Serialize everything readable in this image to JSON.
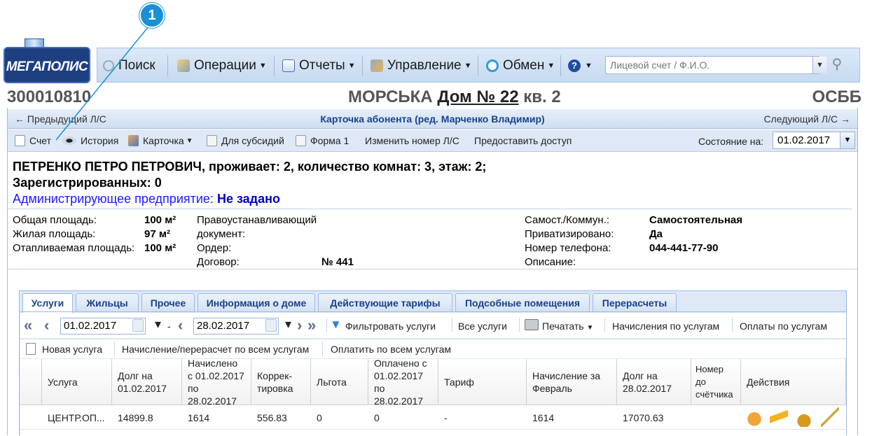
{
  "callout": {
    "number": "1"
  },
  "logo": {
    "text": "МЕГАПОЛИС"
  },
  "menu": {
    "items": [
      {
        "label": "Поиск",
        "icon": "search-icon"
      },
      {
        "label": "Операции",
        "icon": "operations-icon"
      },
      {
        "label": "Отчеты",
        "icon": "reports-icon"
      },
      {
        "label": "Управление",
        "icon": "tools-icon"
      },
      {
        "label": "Обмен",
        "icon": "exchange-icon"
      },
      {
        "label": "",
        "icon": "help-icon"
      }
    ],
    "search_placeholder": "Лицевой счет / Ф.И.О."
  },
  "header": {
    "account": "300010810",
    "street": "МОРСЬКА",
    "house": "Дом № 22",
    "apartment": "кв. 2",
    "org": "ОСББ"
  },
  "card": {
    "prev": "← Предыдущий Л/С",
    "title": "Карточка абонента (ред. Марченко Владимир)",
    "next": "Следующий Л/С →"
  },
  "toolbar": {
    "items": [
      "Счет",
      "История",
      "Карточка",
      "Для субсидий",
      "Форма 1",
      "Изменить номер Л/С",
      "Предоставить доступ"
    ],
    "state_label": "Состояние на:",
    "state_date": "01.02.2017"
  },
  "owner": {
    "line1": "ПЕТРЕНКО ПЕТРО ПЕТРОВИЧ, проживает: 2, количество комнат: 3, этаж: 2;",
    "line2": "Зарегистрированных: 0",
    "admin_label": "Администрирующее предприятие:",
    "admin_value": "Не задано"
  },
  "info": {
    "total_area_label": "Общая площадь:",
    "total_area": "100 м²",
    "living_area_label": "Жилая площадь:",
    "living_area": "97 м²",
    "heated_area_label": "Отапливаемая площадь:",
    "heated_area": "100 м²",
    "doc_label_1": "Правоустанавливающий",
    "doc_label_2": "документ:",
    "order_label": "Ордер:",
    "contract_label": "Договор:",
    "contract": "№ 441",
    "self_label": "Самост./Коммун.:",
    "self": "Самостоятельная",
    "priv_label": "Приватизировано:",
    "priv": "Да",
    "phone_label": "Номер телефона:",
    "phone": "044-441-77-90",
    "desc_label": "Описание:"
  },
  "tabs": [
    "Услуги",
    "Жильцы",
    "Прочее",
    "Информация о доме",
    "Действующие тарифы",
    "Подсобные помещения",
    "Перерасчеты"
  ],
  "services": {
    "date_from": "01.02.2017",
    "date_dash": "-",
    "date_to": "28.02.2017",
    "filter": "Фильтровать услуги",
    "all": "Все услуги",
    "print": "Печатать",
    "charges": "Начисления по услугам",
    "payments": "Оплаты по услугам",
    "new": "Новая услуга",
    "recalc_all": "Начисление/перерасчет по всем услугам",
    "pay_all": "Оплатить по всем услугам"
  },
  "grid": {
    "headers": [
      "Услуга",
      "Долг на 01.02.2017",
      "Начислено с 01.02.2017 по 28.02.2017",
      "Коррек-тировка",
      "Льгота",
      "Оплачено с 01.02.2017 по 28.02.2017",
      "Тариф",
      "Начисление за Февраль",
      "Долг на 28.02.2017",
      "Номер до счётчика",
      "Действия"
    ],
    "row": [
      "ЦЕНТР.ОП...",
      "14899.8",
      "1614",
      "556.83",
      "0",
      "0",
      "-",
      "1614",
      "17070.63",
      ""
    ]
  }
}
